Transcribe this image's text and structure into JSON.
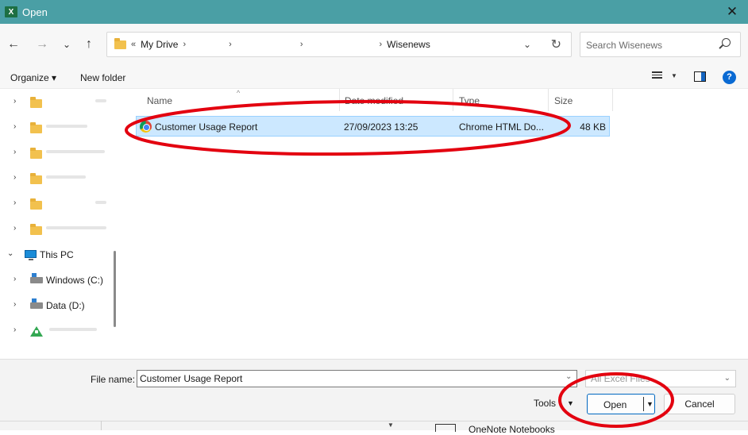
{
  "window": {
    "title": "Open",
    "app_icon_letter": "X",
    "close_glyph": "✕"
  },
  "nav": {
    "back": "←",
    "forward": "→",
    "recent": "⌄",
    "up": "↑"
  },
  "address": {
    "overflow": "«",
    "crumbs": [
      "My Drive",
      "Wisenews"
    ],
    "separator": "›",
    "dropdown": "⌄",
    "refresh": "↻"
  },
  "search": {
    "placeholder": "Search Wisenews"
  },
  "commands": {
    "organize": "Organize ▾",
    "new_folder": "New folder",
    "help": "?"
  },
  "tree": {
    "chevron_collapsed": "›",
    "chevron_expanded": "⌄",
    "this_pc": "This PC",
    "windows_drive": "Windows (C:)",
    "data_drive": "Data (D:)"
  },
  "columns": {
    "name": "Name",
    "date_modified": "Date modified",
    "type": "Type",
    "size": "Size"
  },
  "files": [
    {
      "name": "Customer Usage Report",
      "date_modified": "27/09/2023 13:25",
      "type": "Chrome HTML Do...",
      "size": "48 KB"
    }
  ],
  "footer": {
    "file_name_label": "File name:",
    "file_name_value": "Customer Usage Report",
    "filter": "All Excel Files",
    "tools": "Tools",
    "open": "Open",
    "cancel": "Cancel",
    "behind_text": "OneNote Notebooks"
  },
  "annotation_color": "#e3000f",
  "accent_color": "#0067c0",
  "titlebar_color": "#4a9fa5"
}
